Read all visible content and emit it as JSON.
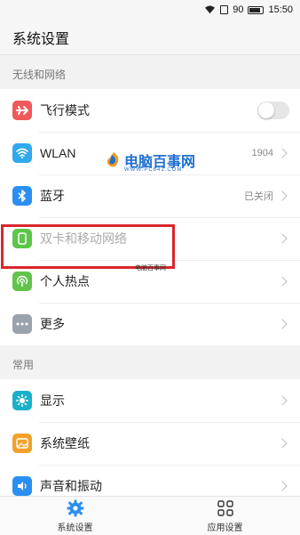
{
  "status_bar": {
    "battery": "90",
    "time": "15:50"
  },
  "title": "系统设置",
  "sections": [
    {
      "header": "无线和网络",
      "items": [
        {
          "label": "飞行模式",
          "icon": "airplane-icon",
          "color": "#f0595a"
        },
        {
          "label": "WLAN",
          "value": "1904",
          "icon": "wifi-icon",
          "color": "#2fa8ee"
        },
        {
          "label": "蓝牙",
          "value": "已关闭",
          "icon": "bluetooth-icon",
          "color": "#2a8ff2"
        },
        {
          "label": "双卡和移动网络",
          "icon": "sim-card-icon",
          "color": "#5cc64a"
        },
        {
          "label": "个人热点",
          "icon": "hotspot-icon",
          "color": "#62c34a"
        },
        {
          "label": "更多",
          "icon": "more-icon",
          "color": "#9aa3ad"
        }
      ]
    },
    {
      "header": "常用",
      "items": [
        {
          "label": "显示",
          "icon": "brightness-icon",
          "color": "#1ab0c9"
        },
        {
          "label": "系统壁纸",
          "icon": "wallpaper-icon",
          "color": "#f3a129"
        },
        {
          "label": "声音和振动",
          "icon": "sound-icon",
          "color": "#2a8ff2"
        }
      ]
    }
  ],
  "watermark": {
    "title": "电脑百事网",
    "sub": "WWW.PC841.COM",
    "small": "电脑百事网"
  },
  "bottom_tabs": [
    {
      "label": "系统设置",
      "icon": "gear-icon",
      "color": "#2a8ff2"
    },
    {
      "label": "应用设置",
      "icon": "apps-grid-icon",
      "color": "#333333"
    }
  ]
}
